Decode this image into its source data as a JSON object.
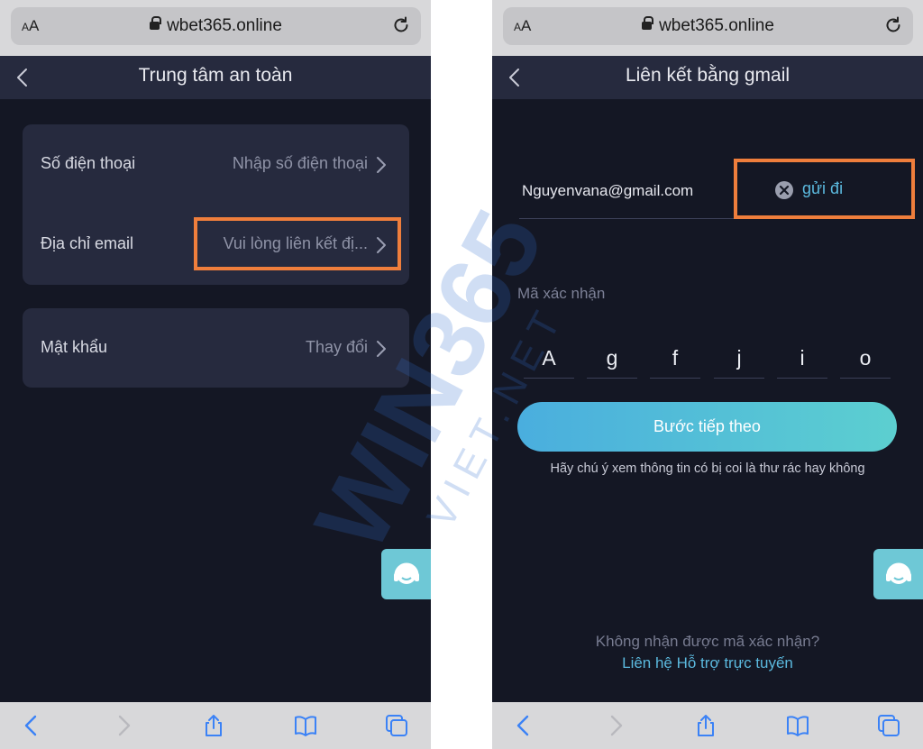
{
  "browser": {
    "aa_label_small": "A",
    "aa_label_large": "A",
    "url": "wbet365.online"
  },
  "left_screen": {
    "title": "Trung tâm an toàn",
    "security_rows": [
      {
        "label": "Số điện thoại",
        "value": "Nhập số điện thoại"
      },
      {
        "label": "Địa chỉ email",
        "value": "Vui lòng liên kết đị..."
      }
    ],
    "password_row": {
      "label": "Mật khẩu",
      "value": "Thay đổi"
    }
  },
  "right_screen": {
    "title": "Liên kết bằng gmail",
    "email_value": "Nguyenvana@gmail.com",
    "send_label": "gửi đi",
    "code_label": "Mã xác nhận",
    "code_chars": [
      "A",
      "g",
      "f",
      "j",
      "i",
      "o"
    ],
    "next_button": "Bước tiếp theo",
    "spam_note": "Hãy chú ý xem thông tin có bị coi là thư rác hay không",
    "no_code_text": "Không nhận được mã xác nhận?",
    "support_link": "Liên hệ Hỗ trợ trực tuyến"
  },
  "watermark": {
    "brand": "WIN365",
    "sub": "VIET.NET"
  },
  "colors": {
    "background": "#141724",
    "card": "#262a3e",
    "highlight": "#ef7e3c",
    "accent_link": "#5bb9de",
    "button_gradient_start": "#4aaede",
    "button_gradient_end": "#5ccfd0",
    "chat_button": "#6ec8d6"
  },
  "icons": [
    "lock-icon",
    "reload-icon",
    "back-chevron-icon",
    "chevron-right-icon",
    "clear-icon",
    "chat-support-icon",
    "nav-back-icon",
    "nav-forward-icon",
    "share-icon",
    "bookmarks-icon",
    "tabs-icon"
  ]
}
